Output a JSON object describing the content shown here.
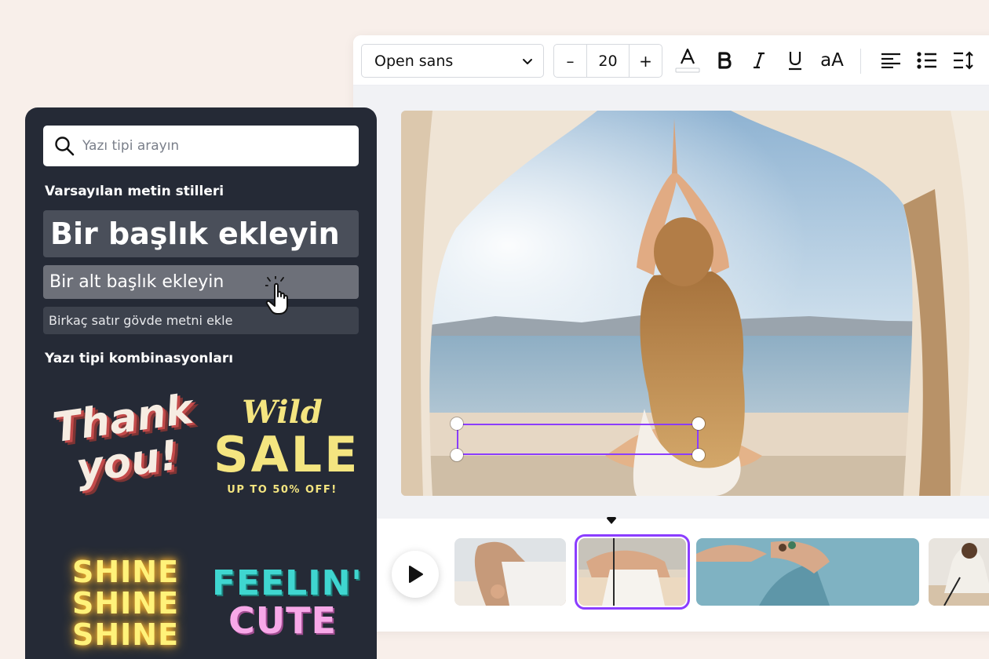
{
  "toolbar": {
    "font_family": "Open sans",
    "font_size": "20",
    "decrease": "–",
    "increase": "+",
    "case_toggle": "aA"
  },
  "panel": {
    "search_placeholder": "Yazı tipi arayın",
    "default_styles_title": "Varsayılan metin stilleri",
    "heading": "Bir başlık ekleyin",
    "subheading": "Bir alt başlık ekleyin",
    "body": "Birkaç satır gövde metni ekle",
    "combinations_title": "Yazı tipi kombinasyonları",
    "combos": {
      "thank_you_1": "Thank",
      "thank_you_2": "you!",
      "wild": "Wild",
      "sale": "SALE",
      "sale_sub": "UP TO 50% OFF!",
      "shine_1": "SHINE",
      "shine_2": "SHINE",
      "shine_3": "SHINE",
      "feelin": "FEELIN'",
      "cute": "CUTE"
    }
  },
  "colors": {
    "accent_purple": "#8b3dff",
    "panel_bg": "#252a36",
    "page_bg": "#f8efea"
  }
}
